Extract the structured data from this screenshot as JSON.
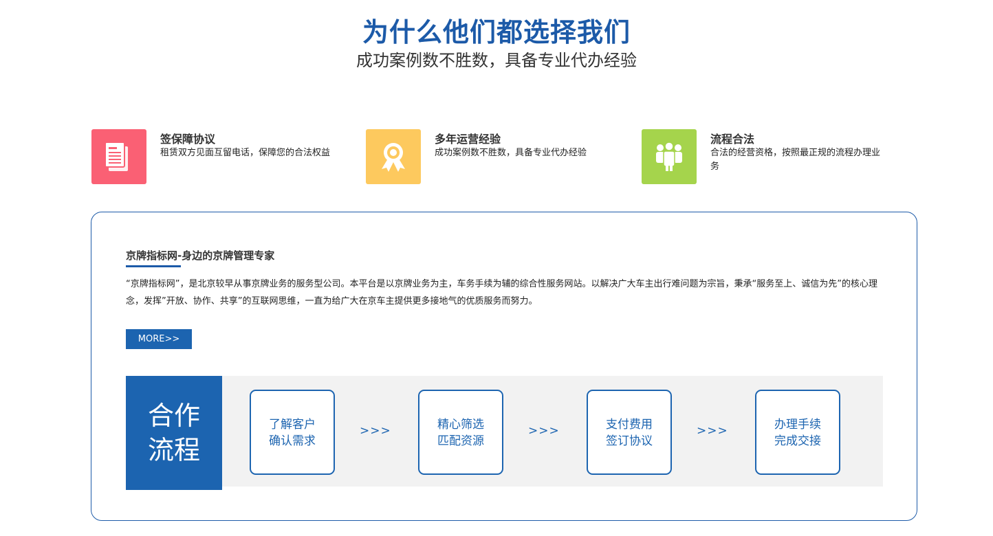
{
  "header": {
    "title": "为什么他们都选择我们",
    "subtitle": "成功案例数不胜数，具备专业代办经验"
  },
  "features": [
    {
      "title": "签保障协议",
      "desc": "租赁双方见面互留电话，保障您的合法权益",
      "icon": "document-icon",
      "color": "#fa6074"
    },
    {
      "title": "多年运营经验",
      "desc": "成功案例数不胜数，具备专业代办经验",
      "icon": "award-ribbon-icon",
      "color": "#fdc95e"
    },
    {
      "title": "流程合法",
      "desc": "合法的经营资格，按照最正规的流程办理业务",
      "icon": "team-icon",
      "color": "#a5d44c"
    }
  ],
  "about": {
    "title": "京牌指标网-身边的京牌管理专家",
    "desc": "“京牌指标网”，是北京较早从事京牌业务的服务型公司。本平台是以京牌业务为主，车务手续为辅的综合性服务网站。以解决广大车主出行难问题为宗旨，秉承“服务至上、诚信为先”的核心理念，发挥”开放、协作、共享”的互联网思维，一直为给广大在京车主提供更多接地气的优质服务而努力。",
    "more_label": "MORE>>"
  },
  "process": {
    "label_line1": "合作",
    "label_line2": "流程",
    "arrow": ">>>",
    "steps": [
      {
        "line1": "了解客户",
        "line2": "确认需求"
      },
      {
        "line1": "精心筛选",
        "line2": "匹配资源"
      },
      {
        "line1": "支付费用",
        "line2": "签订协议"
      },
      {
        "line1": "办理手续",
        "line2": "完成交接"
      }
    ]
  },
  "colors": {
    "brand": "#1c5aa8",
    "button": "#1c64b0"
  }
}
